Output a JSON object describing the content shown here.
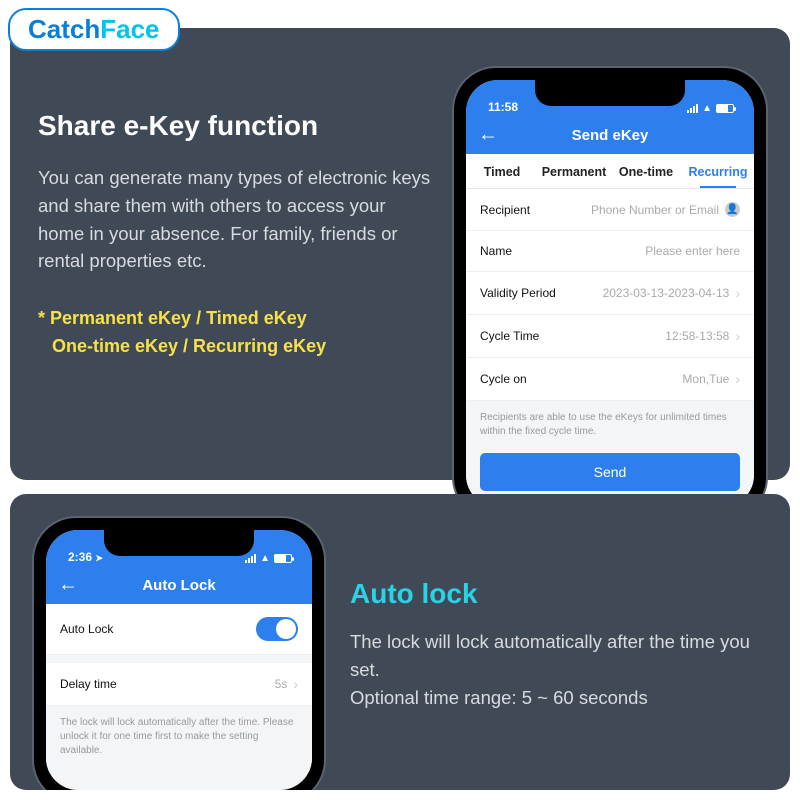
{
  "logo": {
    "part1": "Catch",
    "part2": "Face"
  },
  "section1": {
    "title": "Share e-Key function",
    "body": "You can generate many types of electronic keys and share them with others to access your home in your absence. For family, friends or rental properties etc.",
    "bullets_line1": "* Permanent eKey /  Timed eKey",
    "bullets_line2": "One-time eKey /  Recurring eKey"
  },
  "phone1": {
    "time": "11:58",
    "nav_title": "Send eKey",
    "tabs": {
      "timed": "Timed",
      "permanent": "Permanent",
      "onetime": "One-time",
      "recurring": "Recurring"
    },
    "rows": {
      "recipient_label": "Recipient",
      "recipient_placeholder": "Phone Number or Email",
      "name_label": "Name",
      "name_placeholder": "Please enter here",
      "validity_label": "Validity Period",
      "validity_value": "2023-03-13-2023-04-13",
      "cycletime_label": "Cycle Time",
      "cycletime_value": "12:58-13:58",
      "cycleon_label": "Cycle on",
      "cycleon_value": "Mon,Tue"
    },
    "note": "Recipients are able to use the eKeys for unlimited times within the fixed cycle time.",
    "send": "Send"
  },
  "section2": {
    "title": "Auto lock",
    "body_line1": "The lock will lock automatically after the time you set.",
    "body_line2": "Optional time range: 5 ~ 60 seconds"
  },
  "phone2": {
    "time": "2:36",
    "nav_title": "Auto Lock",
    "rows": {
      "autolock_label": "Auto Lock",
      "delay_label": "Delay time",
      "delay_value": "5s"
    },
    "note": "The lock will lock automatically after the time. Please unlock it for one time first to make the setting available."
  }
}
